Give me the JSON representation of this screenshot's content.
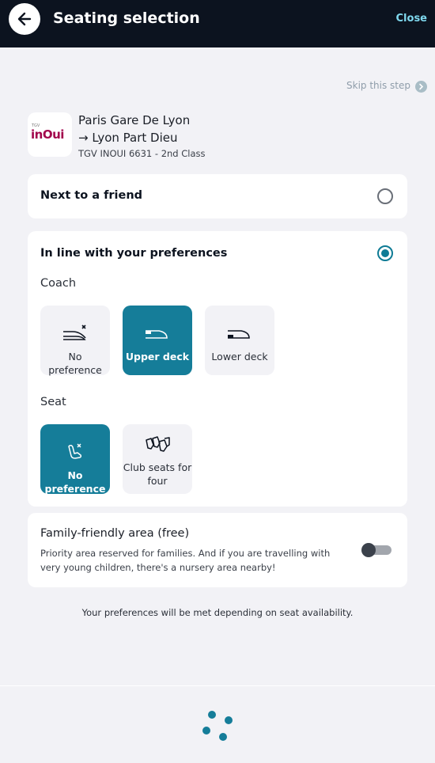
{
  "header": {
    "title": "Seating selection",
    "close_label": "Close",
    "back_icon": "arrow-left-icon"
  },
  "skip": {
    "label": "Skip this step",
    "icon": "chevron-right-icon"
  },
  "train": {
    "logo_small": "TGV",
    "logo_text": "inOui",
    "from": "Paris Gare De Lyon",
    "to": "Lyon Part Dieu",
    "arrow": "→",
    "info": "TGV INOUI 6631 - 2nd Class"
  },
  "option_friend": {
    "title": "Next to a friend",
    "selected": false
  },
  "option_pref": {
    "title": "In line with your preferences",
    "selected": true,
    "coach_label": "Coach",
    "coach_options": [
      {
        "label": "No preference",
        "selected": false,
        "icon": "train-no-preference-icon"
      },
      {
        "label": "Upper deck",
        "selected": true,
        "icon": "train-upper-deck-icon"
      },
      {
        "label": "Lower deck",
        "selected": false,
        "icon": "train-lower-deck-icon"
      }
    ],
    "seat_label": "Seat",
    "seat_options": [
      {
        "label": "No preference",
        "selected": true,
        "icon": "seat-no-preference-icon"
      },
      {
        "label_line1": "Club seats for",
        "label_line2": "four",
        "selected": false,
        "icon": "club-seats-icon"
      }
    ]
  },
  "family": {
    "title": "Family-friendly area (free)",
    "desc_line1": "Priority area reserved for families. And if you are travelling with",
    "desc_line2": "very young children, there's a nursery area nearby!",
    "enabled": false
  },
  "note": "Your preferences will be met depending on seat availability.",
  "colors": {
    "header": "#0c131f",
    "accent": "#157d99",
    "close": "#7fd8ee",
    "brand": "#a2064c"
  }
}
